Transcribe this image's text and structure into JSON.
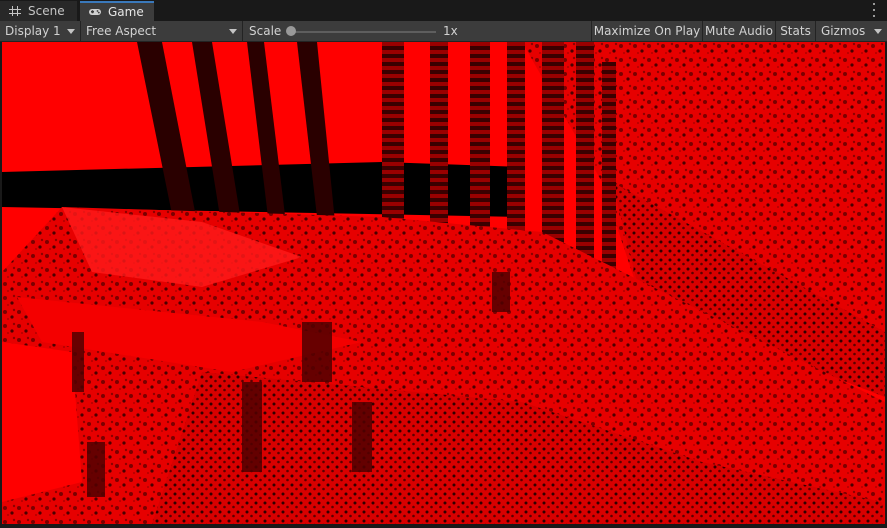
{
  "tabs": [
    {
      "label": "Scene",
      "icon": "grid-icon"
    },
    {
      "label": "Game",
      "icon": "gamepad-icon"
    }
  ],
  "toolbar": {
    "display": "Display 1",
    "aspect": "Free Aspect",
    "scale_label": "Scale",
    "scale_value": "1x",
    "scale_slider": 0.0,
    "maximize": "Maximize On Play",
    "mute": "Mute Audio",
    "stats": "Stats",
    "gizmos": "Gizmos"
  },
  "colors": {
    "accent": "#3a79bb",
    "render_tint": "#ff0000"
  }
}
